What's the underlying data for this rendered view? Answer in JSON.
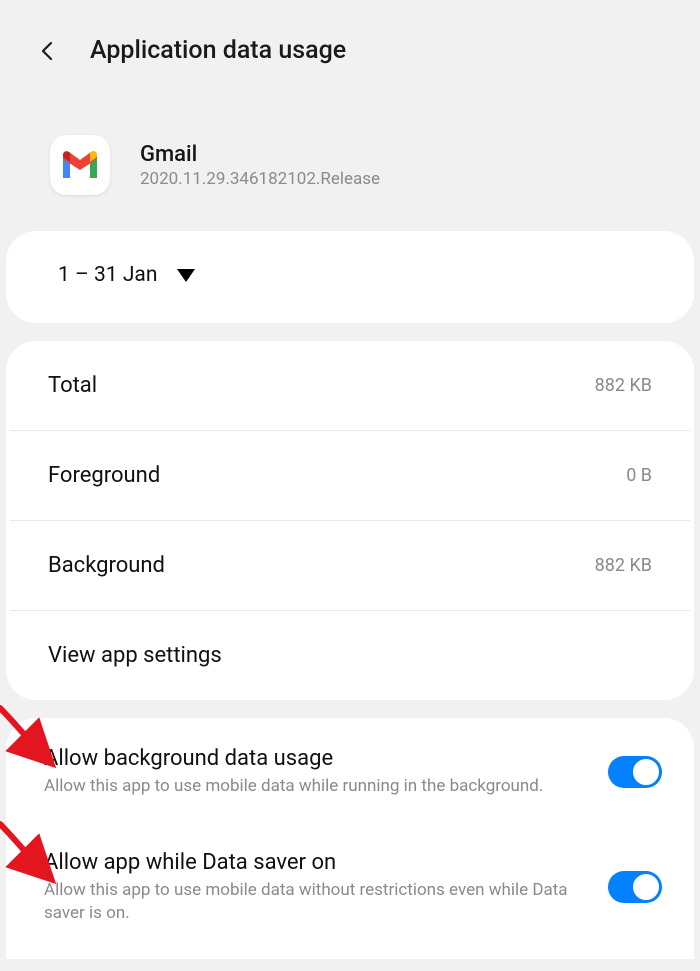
{
  "header": {
    "title": "Application data usage"
  },
  "app": {
    "name": "Gmail",
    "version": "2020.11.29.346182102.Release"
  },
  "period": {
    "range": "1 – 31 Jan"
  },
  "usage": {
    "total": {
      "label": "Total",
      "value": "882 KB"
    },
    "foreground": {
      "label": "Foreground",
      "value": "0 B"
    },
    "background": {
      "label": "Background",
      "value": "882 KB"
    },
    "settings": {
      "label": "View app settings"
    }
  },
  "toggles": {
    "bg": {
      "title": "Allow background data usage",
      "desc": "Allow this app to use mobile data while running in the background.",
      "on": true
    },
    "saver": {
      "title": "Allow app while Data saver on",
      "desc": "Allow this app to use mobile data without restrictions even while Data saver is on.",
      "on": true
    }
  }
}
